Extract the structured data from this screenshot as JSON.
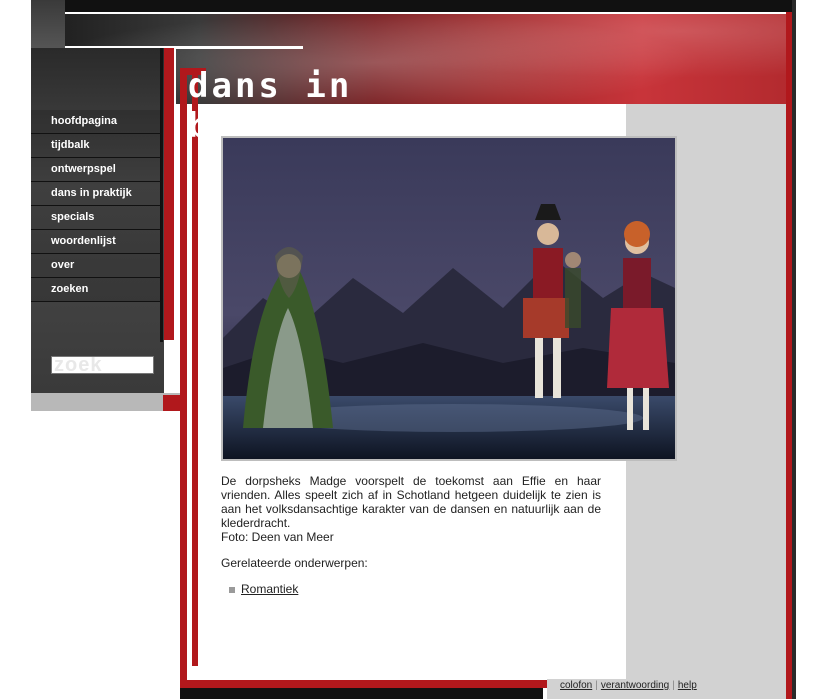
{
  "header": {
    "title_text": "dans in beeld!"
  },
  "nav": {
    "items": [
      {
        "label": "hoofdpagina"
      },
      {
        "label": "tijdbalk"
      },
      {
        "label": "ontwerpspel"
      },
      {
        "label": "dans in praktijk"
      },
      {
        "label": "specials"
      },
      {
        "label": "woordenlijst"
      },
      {
        "label": "over"
      },
      {
        "label": "zoeken"
      }
    ],
    "search_label": "zoek"
  },
  "main": {
    "caption": "De dorpsheks Madge voorspelt de toekomst aan Effie en haar vrienden. Alles speelt zich af in Schotland hetgeen duidelijk te zien is aan het volksdansachtige karakter van de dansen en natuurlijk aan de klederdracht.",
    "photo_credit": "Foto: Deen van Meer",
    "related_title": "Gerelateerde onderwerpen:",
    "related_links": [
      "Romantiek"
    ]
  },
  "footer": {
    "links": [
      "colofon",
      "verantwoording",
      "help"
    ]
  },
  "colors": {
    "brand_red": "#b1181c",
    "panel_gray": "#d2d2d2"
  }
}
